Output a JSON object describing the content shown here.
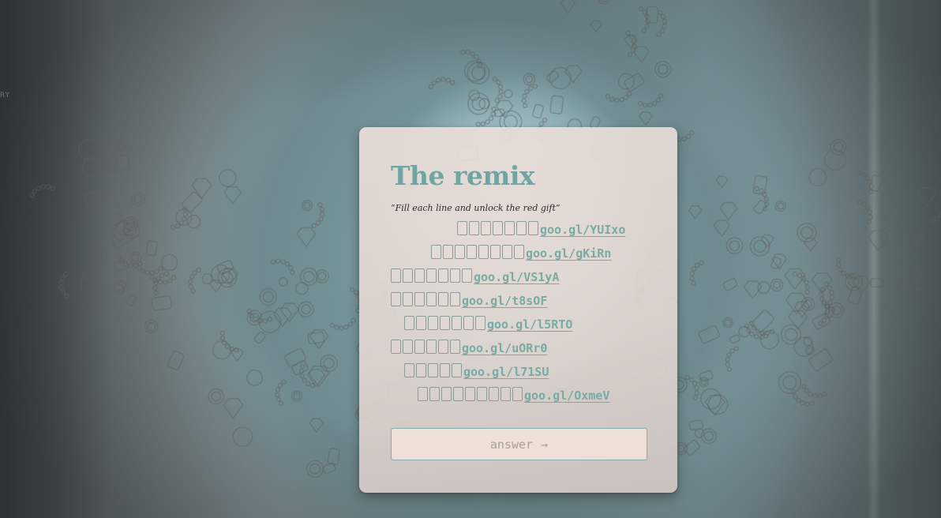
{
  "card": {
    "title": "The remix",
    "subtitle": "“Fill each line and unlock the red gift”"
  },
  "puzzle_lines": [
    {
      "boxes": 7,
      "link": "goo.gl/YUIxo"
    },
    {
      "boxes": 8,
      "link": "goo.gl/gKiRn"
    },
    {
      "boxes": 7,
      "link": "goo.gl/VS1yA"
    },
    {
      "boxes": 6,
      "link": "goo.gl/t8sOF"
    },
    {
      "boxes": 7,
      "link": "goo.gl/l5RTO"
    },
    {
      "boxes": 6,
      "link": "goo.gl/uORr0"
    },
    {
      "boxes": 5,
      "link": "goo.gl/l71SU"
    },
    {
      "boxes": 9,
      "link": "goo.gl/OxmeV"
    }
  ],
  "answer_button": {
    "label": "answer",
    "arrow": "→"
  },
  "colors": {
    "accent": "#6fa6a3",
    "link": "#78aba6",
    "card": "#e8dcd6"
  }
}
